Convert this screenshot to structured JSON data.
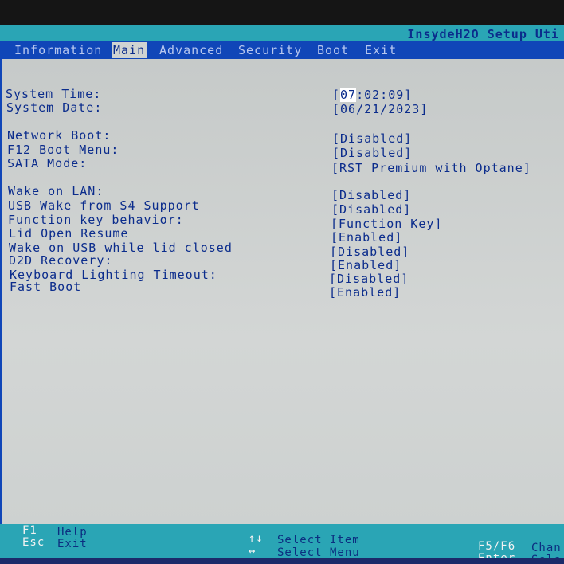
{
  "header": {
    "product_title": "InsydeH2O Setup Uti"
  },
  "menu": {
    "tabs": [
      {
        "label": "Information"
      },
      {
        "label": "Main"
      },
      {
        "label": "Advanced"
      },
      {
        "label": "Security"
      },
      {
        "label": "Boot"
      },
      {
        "label": "Exit"
      }
    ],
    "active_tab": "Main"
  },
  "settings": [
    {
      "label": "System Time:",
      "value": "[07:02:09]"
    },
    {
      "label": "System Date:",
      "value": "[06/21/2023]"
    },
    {
      "label": "Network Boot:",
      "value": "[Disabled]"
    },
    {
      "label": "F12 Boot Menu:",
      "value": "[Disabled]"
    },
    {
      "label": "SATA Mode:",
      "value": "[RST Premium with Optane]"
    },
    {
      "label": "Wake on LAN:",
      "value": "[Disabled]"
    },
    {
      "label": "USB Wake from S4 Support",
      "value": "[Disabled]"
    },
    {
      "label": "Function key behavior:",
      "value": "[Function Key]"
    },
    {
      "label": "Lid Open Resume",
      "value": "[Enabled]"
    },
    {
      "label": "Wake on USB while lid closed",
      "value": "[Disabled]"
    },
    {
      "label": "D2D Recovery:",
      "value": "[Enabled]"
    },
    {
      "label": "Keyboard Lighting Timeout:",
      "value": "[Disabled]"
    },
    {
      "label": "Fast Boot",
      "value": "[Enabled]"
    }
  ],
  "system_time": {
    "open": "[",
    "hours": "07",
    "rest": ":02:09]"
  },
  "help": {
    "f1_key": "F1",
    "f1_desc": "Help",
    "esc_key": "Esc",
    "esc_desc": "Exit",
    "updown_key": "↑↓",
    "updown_desc": "Select Item",
    "leftright_key": "↔",
    "leftright_desc": "Select Menu",
    "f5f6_key": "F5/F6",
    "f5f6_desc": "Chan",
    "enter_key": "Enter",
    "enter_desc": "Sele"
  },
  "colors": {
    "menu_bar": "#1046b8",
    "accent_bar": "#2aa5b5",
    "panel_bg": "#c9cdcc",
    "text": "#0b2c8c"
  }
}
